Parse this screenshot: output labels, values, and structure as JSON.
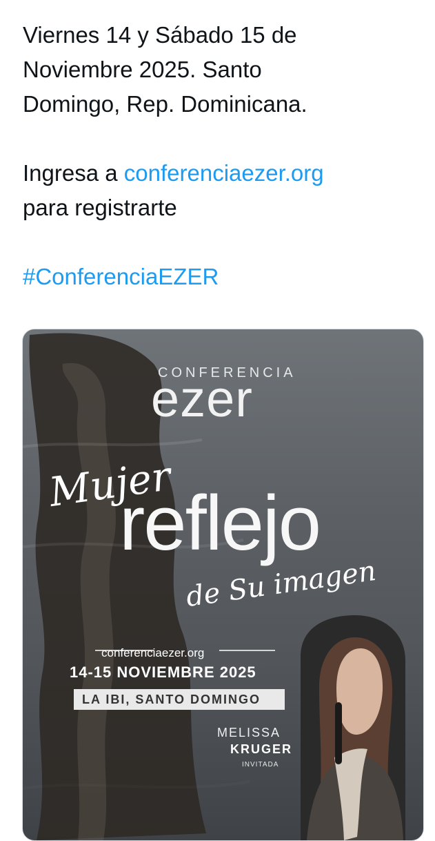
{
  "tweet": {
    "line1": "Viernes 14 y Sábado 15 de",
    "line2": "Noviembre 2025. Santo",
    "line3": "Domingo, Rep. Dominicana.",
    "register_prefix": "Ingresa a ",
    "register_link": "conferenciaezer.org",
    "register_suffix": "para registrarte",
    "hashtag": "#ConferenciaEZER"
  },
  "poster": {
    "conference_label": "CONFERENCIA",
    "brand": "ezer",
    "title_script": "Mujer",
    "title_main": "reflejo",
    "title_sub": "de Su imagen",
    "website": "conferenciaezer.org",
    "dates": "14-15 NOVIEMBRE 2025",
    "venue": "LA IBI, SANTO DOMINGO",
    "speaker_first": "MELISSA",
    "speaker_last": "KRUGER",
    "speaker_role": "INVITADA"
  },
  "colors": {
    "link": "#1d9bf0",
    "text": "#0f1419",
    "poster_background": "#5b5f63"
  },
  "icons": {
    "reflection_image": "water-reflection-photo",
    "speaker_photo": "speaker-portrait-photo"
  }
}
